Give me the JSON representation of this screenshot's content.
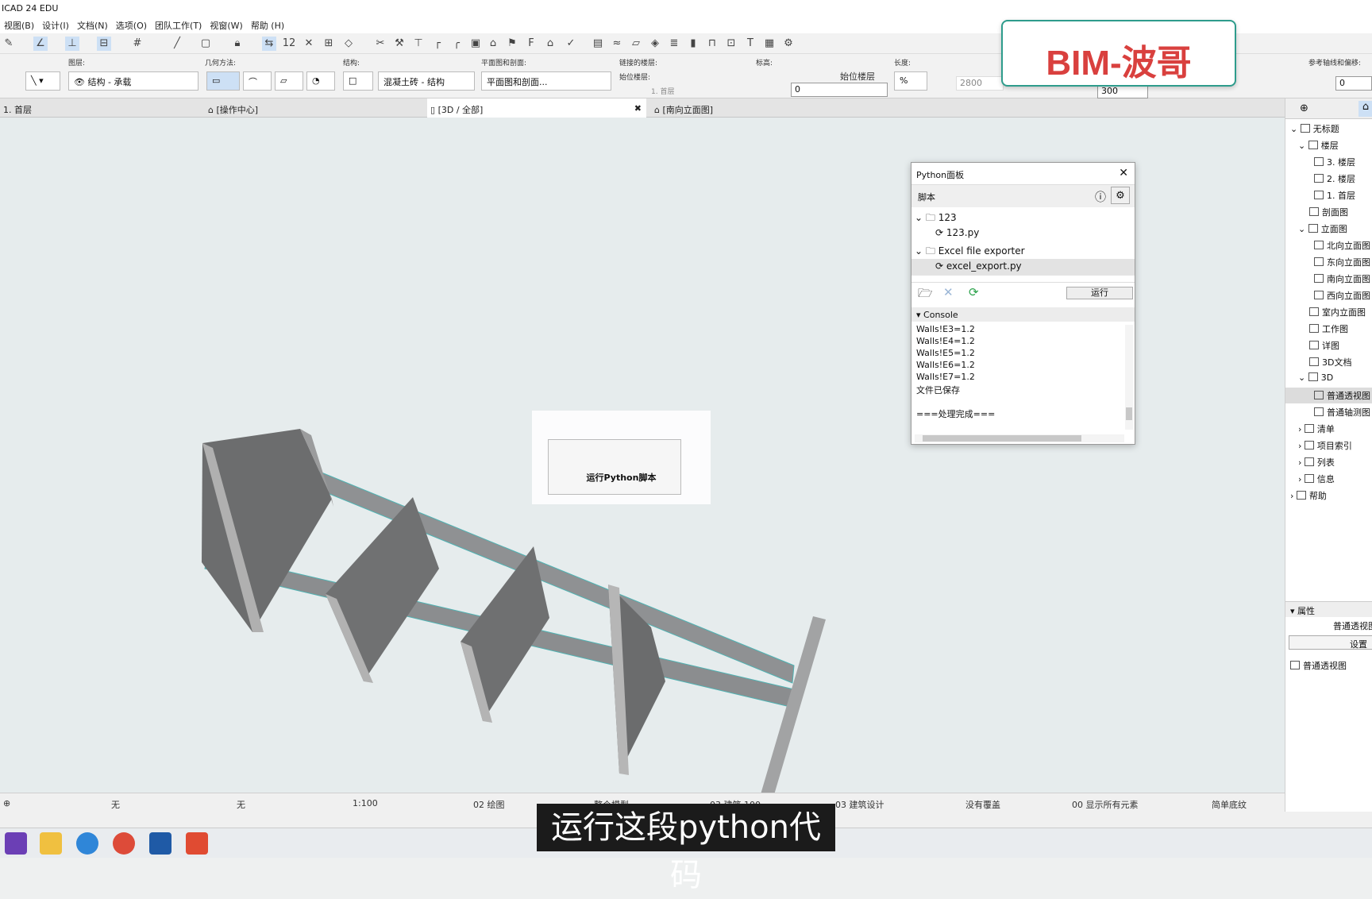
{
  "app": {
    "title": "ICAD 24 EDU"
  },
  "menu": [
    "视图(B)",
    "设计(I)",
    "文档(N)",
    "选项(O)",
    "团队工作(T)",
    "视窗(W)",
    "帮助 (H)"
  ],
  "infobox": {
    "layer_label": "图层:",
    "layer_value": "结构 - 承载",
    "geom_label": "几何方法:",
    "struct_label": "结构:",
    "struct_value": "混凝土砖 - 结构",
    "plan_label": "平面图和剖面:",
    "plan_value": "平面图和剖面...",
    "link_label": "链接的楼层:",
    "home_label": "始位楼层:",
    "home_value": "1. 首层",
    "elev_label": "标高:",
    "elev_home": "始位楼层",
    "elev_value": "0",
    "length_label": "长度:",
    "length_value": "2800",
    "thickness_value": "300",
    "ref_label": "参考轴线和偏移:",
    "ref_value": "0"
  },
  "watermark": "BIM-波哥",
  "tabs": [
    "1. 首层",
    "[操作中心]",
    "[3D / 全部]",
    "[南向立面图]"
  ],
  "python_panel": {
    "title": "Python面板",
    "section": "脚本",
    "tree": [
      {
        "label": "123",
        "type": "folder"
      },
      {
        "label": "123.py",
        "type": "file"
      },
      {
        "label": "Excel file exporter",
        "type": "folder"
      },
      {
        "label": "excel_export.py",
        "type": "file"
      }
    ],
    "run_label": "运行",
    "console_label": "Console",
    "console": [
      "Walls!E3=1.2",
      "Walls!E4=1.2",
      "Walls!E5=1.2",
      "Walls!E6=1.2",
      "Walls!E7=1.2",
      "文件已保存",
      "",
      "===处理完成==="
    ]
  },
  "overlay": {
    "label": "运行Python脚本"
  },
  "navigator": {
    "items": [
      "无标题",
      "楼层",
      "3. 楼层",
      "2. 楼层",
      "1. 首层",
      "剖面图",
      "立面图",
      "北向立面图",
      "东向立面图",
      "南向立面图",
      "西向立面图",
      "室内立面图",
      "工作图",
      "详图",
      "3D文档",
      "3D",
      "普通透视图",
      "普通轴测图",
      "清单",
      "项目索引",
      "列表",
      "信息",
      "帮助"
    ],
    "properties_label": "属性",
    "prop_value": "普通透视图",
    "settings_label": "设置",
    "view_label": "普通透视图"
  },
  "status": {
    "a": "无",
    "b": "无",
    "scale": "1:100",
    "pen": "02 绘图",
    "model": "整个模型",
    "struct": "03 建筑 100",
    "design": "03 建筑设计",
    "override": "没有覆盖",
    "show": "00 显示所有元素",
    "sketch": "简单底纹"
  },
  "subtitle": "运行这段python代码"
}
